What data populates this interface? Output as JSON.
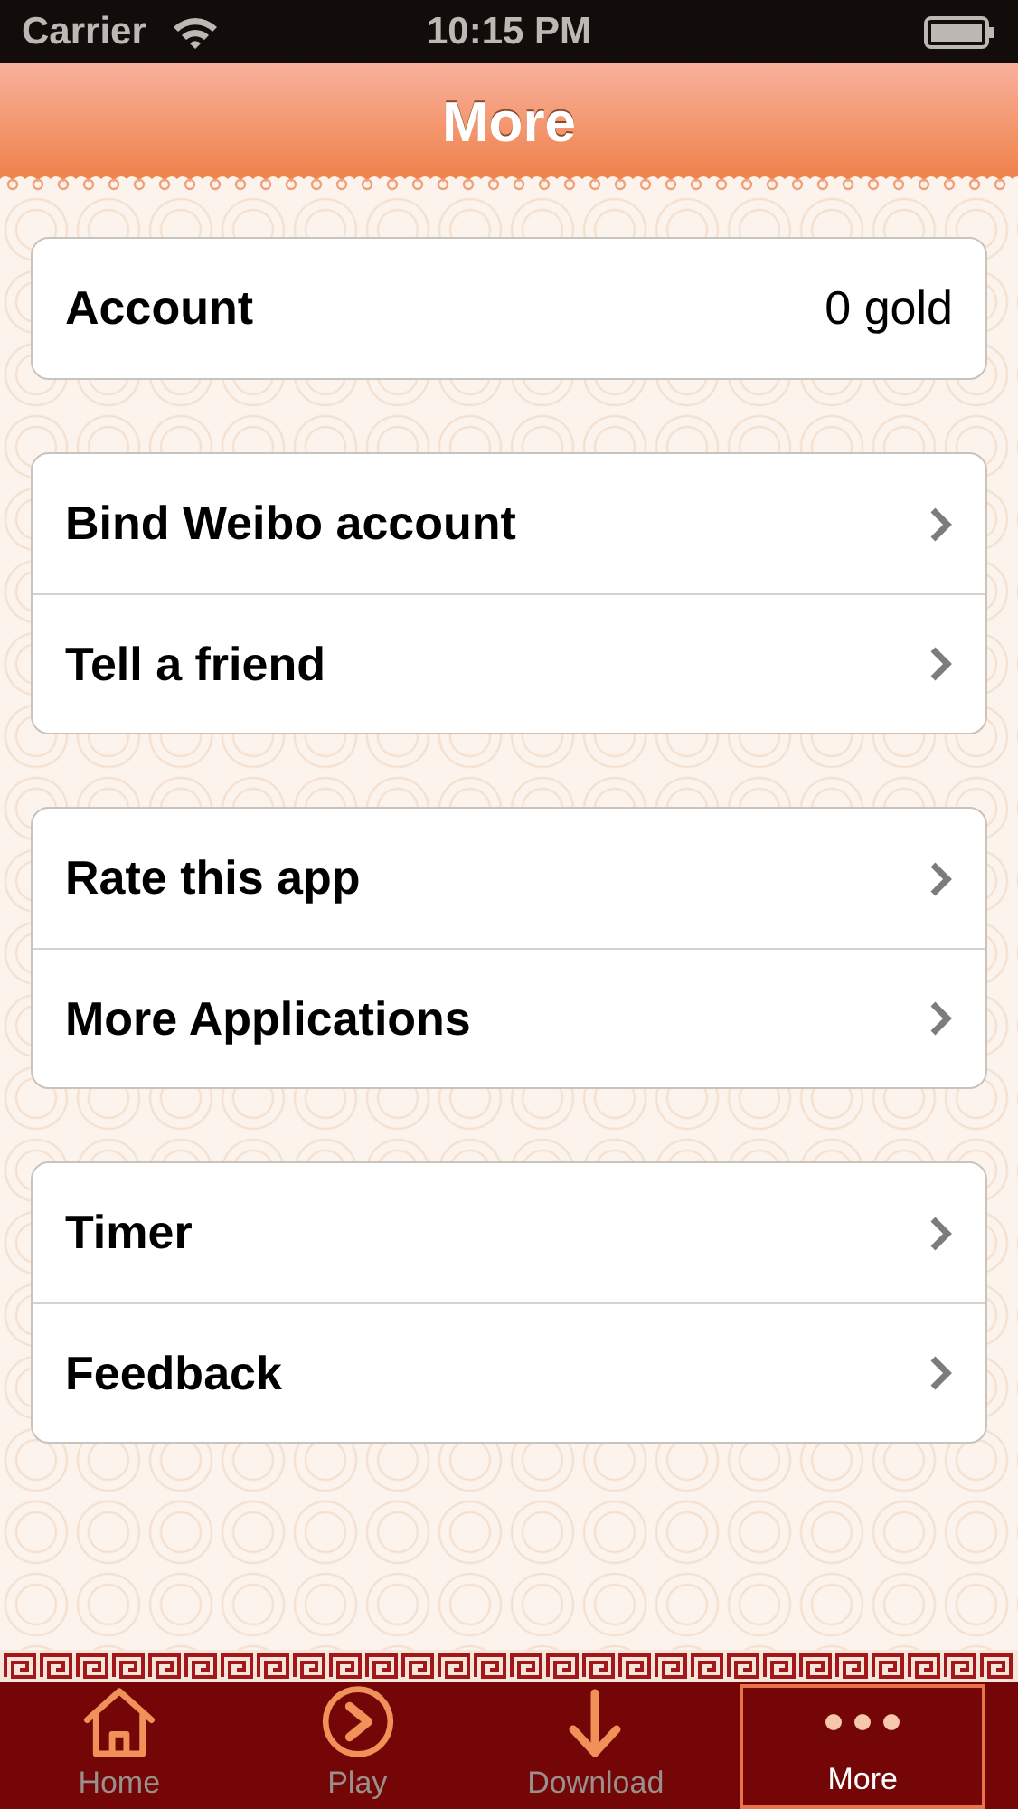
{
  "status_bar": {
    "carrier": "Carrier",
    "time": "10:15 PM"
  },
  "nav_bar": {
    "title": "More"
  },
  "groups": [
    {
      "rows": [
        {
          "kind": "value",
          "label": "Account",
          "value": "0 gold"
        }
      ]
    },
    {
      "rows": [
        {
          "kind": "disclosure",
          "label": "Bind Weibo account"
        },
        {
          "kind": "disclosure",
          "label": "Tell a friend"
        }
      ]
    },
    {
      "rows": [
        {
          "kind": "disclosure",
          "label": "Rate this app"
        },
        {
          "kind": "disclosure",
          "label": "More Applications"
        }
      ]
    },
    {
      "rows": [
        {
          "kind": "disclosure",
          "label": "Timer"
        },
        {
          "kind": "disclosure",
          "label": "Feedback"
        }
      ]
    }
  ],
  "tabs": [
    {
      "label": "Home",
      "selected": false
    },
    {
      "label": "Play",
      "selected": false
    },
    {
      "label": "Download",
      "selected": false
    },
    {
      "label": "More",
      "selected": true
    }
  ]
}
